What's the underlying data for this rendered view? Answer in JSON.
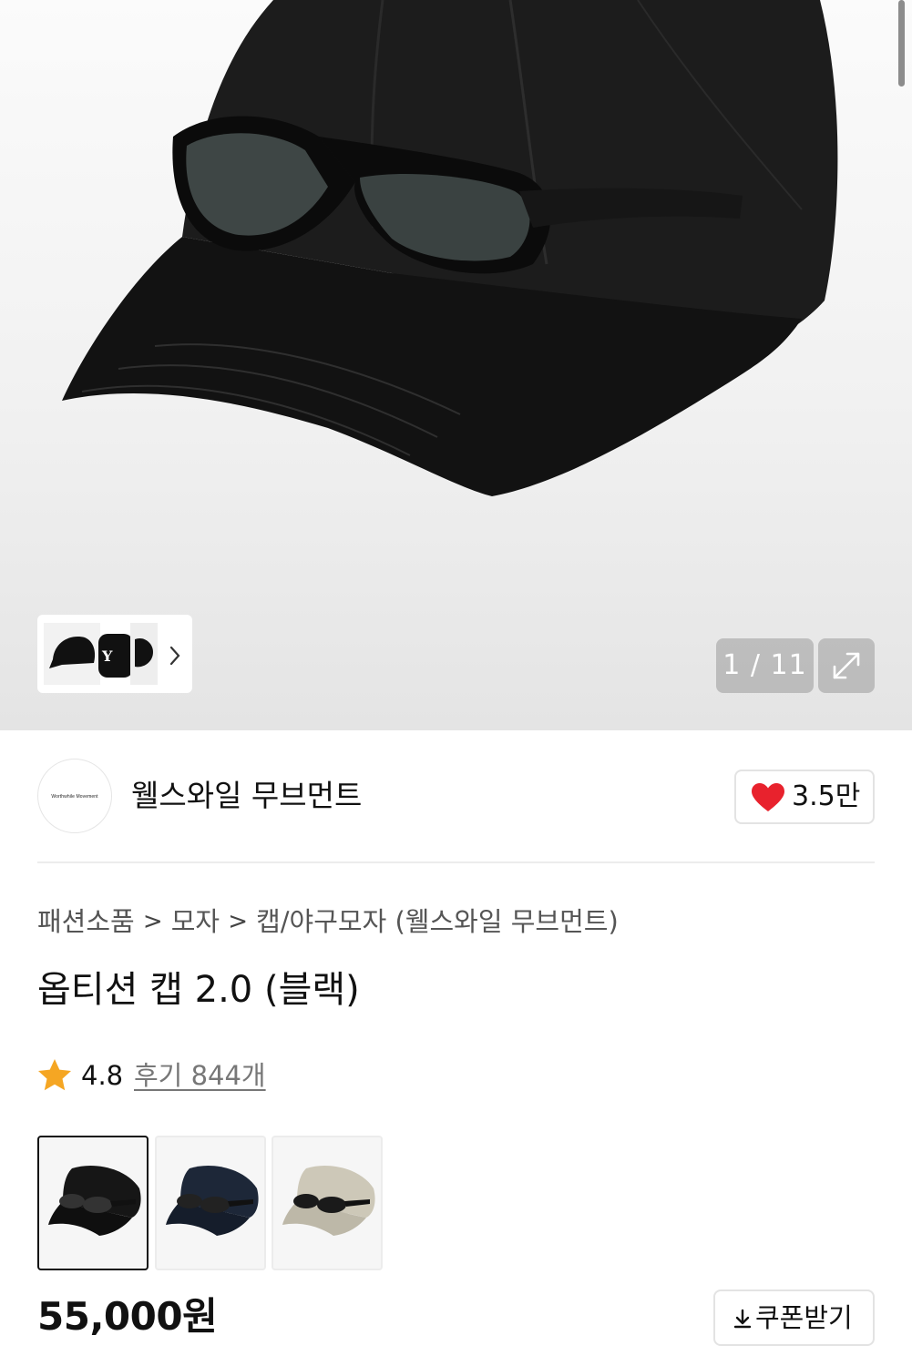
{
  "gallery": {
    "counter": "1 / 11",
    "thumbnail_letter": "Y"
  },
  "brand": {
    "logo_text": "Worthwhile Movement",
    "name": "웰스와일 무브먼트",
    "like_count": "3.5만"
  },
  "breadcrumb": {
    "items": [
      "패션소품",
      "모자",
      "캡/야구모자 (웰스와일 무브먼트)"
    ],
    "separator": ">"
  },
  "product": {
    "title": "옵티션 캡 2.0 (블랙)",
    "rating": "4.8",
    "review_link": "후기 844개",
    "price": "55,000원"
  },
  "swatches": [
    {
      "color": "#161616",
      "selected": true
    },
    {
      "color": "#1d2738",
      "selected": false
    },
    {
      "color": "#cdc8b8",
      "selected": false
    }
  ],
  "coupon": {
    "label": "쿠폰받기"
  },
  "colors": {
    "heart": "#e8222d",
    "star": "#f5a623"
  }
}
